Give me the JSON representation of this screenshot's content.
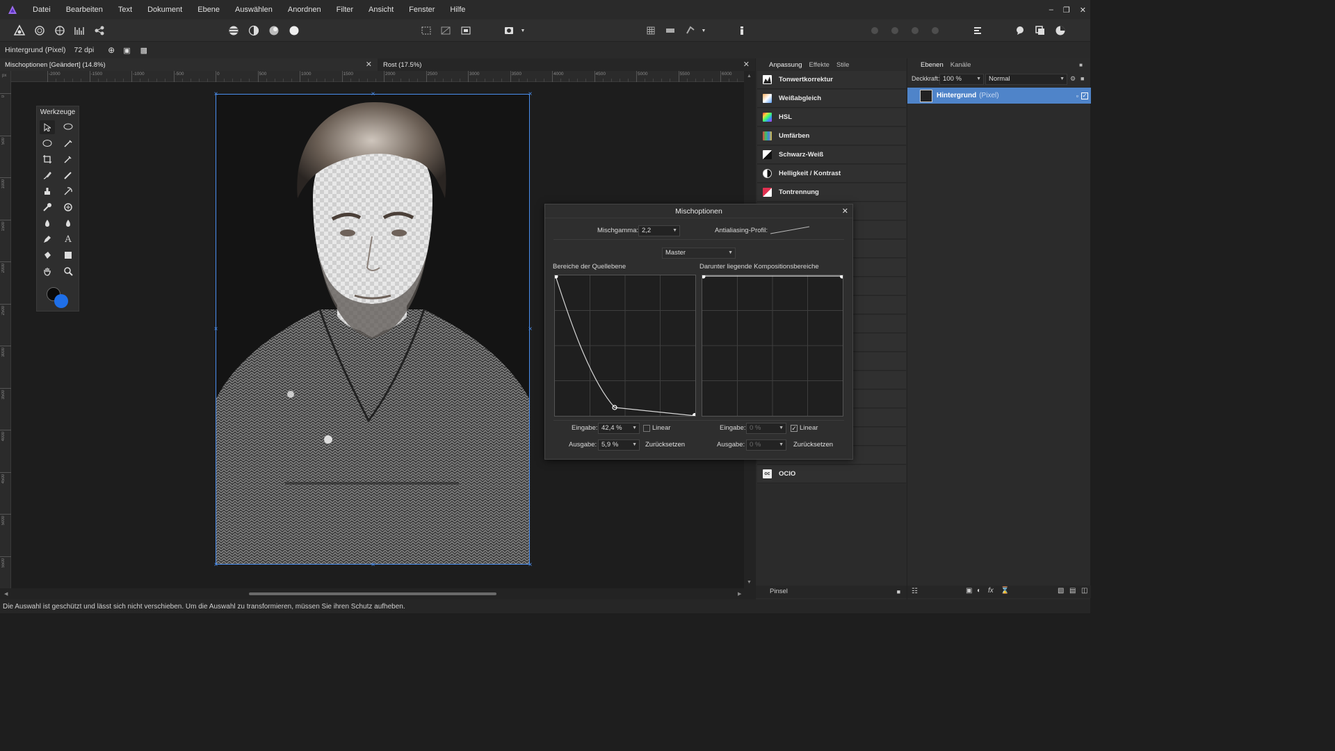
{
  "menu": [
    "Datei",
    "Bearbeiten",
    "Text",
    "Dokument",
    "Ebene",
    "Auswählen",
    "Anordnen",
    "Filter",
    "Ansicht",
    "Fenster",
    "Hilfe"
  ],
  "context": {
    "layer": "Hintergrund (Pixel)",
    "dpi": "72 dpi"
  },
  "tabs": [
    {
      "label": "Mischoptionen [Geändert] (14.8%)"
    },
    {
      "label": "Rost (17.5%)"
    }
  ],
  "ruler": {
    "unit": "px",
    "h_ticks": [
      "-2000",
      "-1500",
      "-1000",
      "-500",
      "0",
      "500",
      "1000",
      "1500",
      "2000",
      "2500",
      "3000",
      "3500",
      "4000",
      "4500",
      "5000",
      "5500",
      "6000"
    ],
    "v_ticks": [
      "0",
      "500",
      "1000",
      "1500",
      "2000",
      "2500",
      "3000",
      "3500",
      "4000",
      "4500",
      "5000",
      "5500"
    ]
  },
  "tools_panel": {
    "title": "Werkzeuge"
  },
  "adjustments_panel": {
    "tabs": [
      "Anpassung",
      "Effekte",
      "Stile"
    ],
    "items": [
      "Tonwertkorrektur",
      "Weißabgleich",
      "HSL",
      "Umfärben",
      "Schwarz-Weiß",
      "Helligkeit / Kontrast",
      "Tontrennung"
    ],
    "ocio": "OCIO",
    "footer": "Pinsel"
  },
  "layers_panel": {
    "tabs": [
      "Ebenen",
      "Kanäle"
    ],
    "opacity_label": "Deckkraft:",
    "opacity_value": "100 %",
    "blend_mode": "Normal",
    "layer_name": "Hintergrund",
    "layer_type": "(Pixel)"
  },
  "dialog": {
    "title": "Mischoptionen",
    "gamma_label": "Mischgamma:",
    "gamma_value": "2,2",
    "aa_label": "Antialiasing-Profil:",
    "channel": "Master",
    "source_label": "Bereiche der Quellebene",
    "underlying_label": "Darunter liegende Kompositionsbereiche",
    "source": {
      "input_label": "Eingabe:",
      "input_value": "42,4 %",
      "output_label": "Ausgabe:",
      "output_value": "5,9 %",
      "linear_label": "Linear",
      "linear_checked": false,
      "reset_label": "Zurücksetzen"
    },
    "underlying": {
      "input_label": "Eingabe:",
      "input_value": "0 %",
      "output_label": "Ausgabe:",
      "output_value": "0 %",
      "linear_label": "Linear",
      "linear_checked": true,
      "reset_label": "Zurücksetzen"
    }
  },
  "status": "Die Auswahl ist geschützt und lässt sich nicht verschieben. Um die Auswahl zu transformieren, müssen Sie ihren Schutz aufheben."
}
